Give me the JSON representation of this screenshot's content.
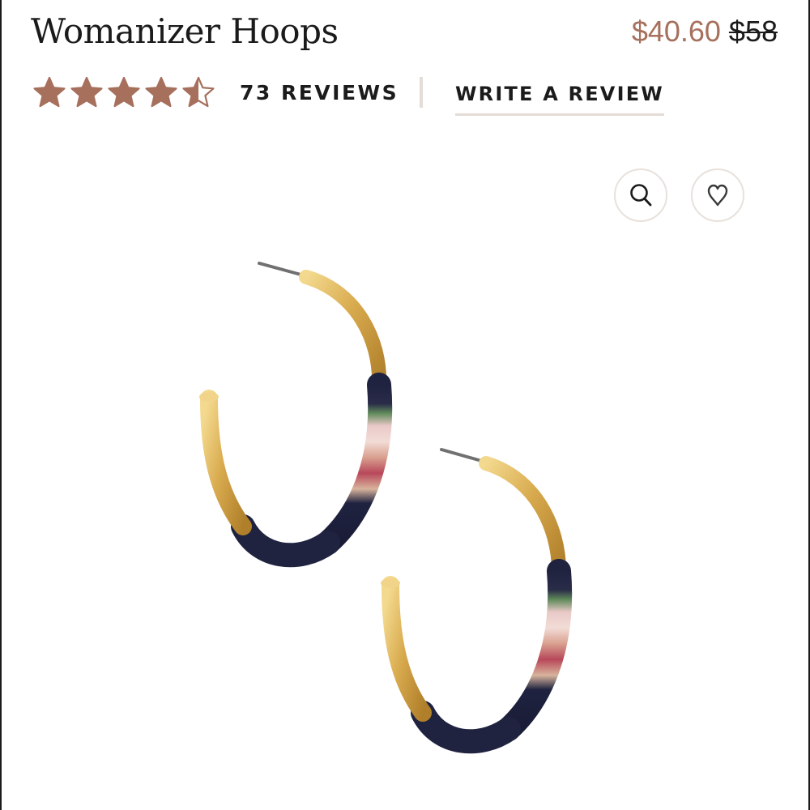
{
  "product": {
    "title": "Womanizer Hoops",
    "sale_price": "$40.60",
    "original_price": "$58"
  },
  "rating": {
    "value": 4.5,
    "max": 5,
    "star_color": "#a6705d",
    "reviews_label": "73 REVIEWS"
  },
  "actions": {
    "write_review_label": "WRITE A REVIEW",
    "zoom_icon": "magnifier-icon",
    "wishlist_icon": "heart-icon"
  },
  "colors": {
    "accent": "#a6705d",
    "divider": "#e4dcd6",
    "gold": "#d4a94c",
    "wrap_navy": "#1f2340"
  }
}
